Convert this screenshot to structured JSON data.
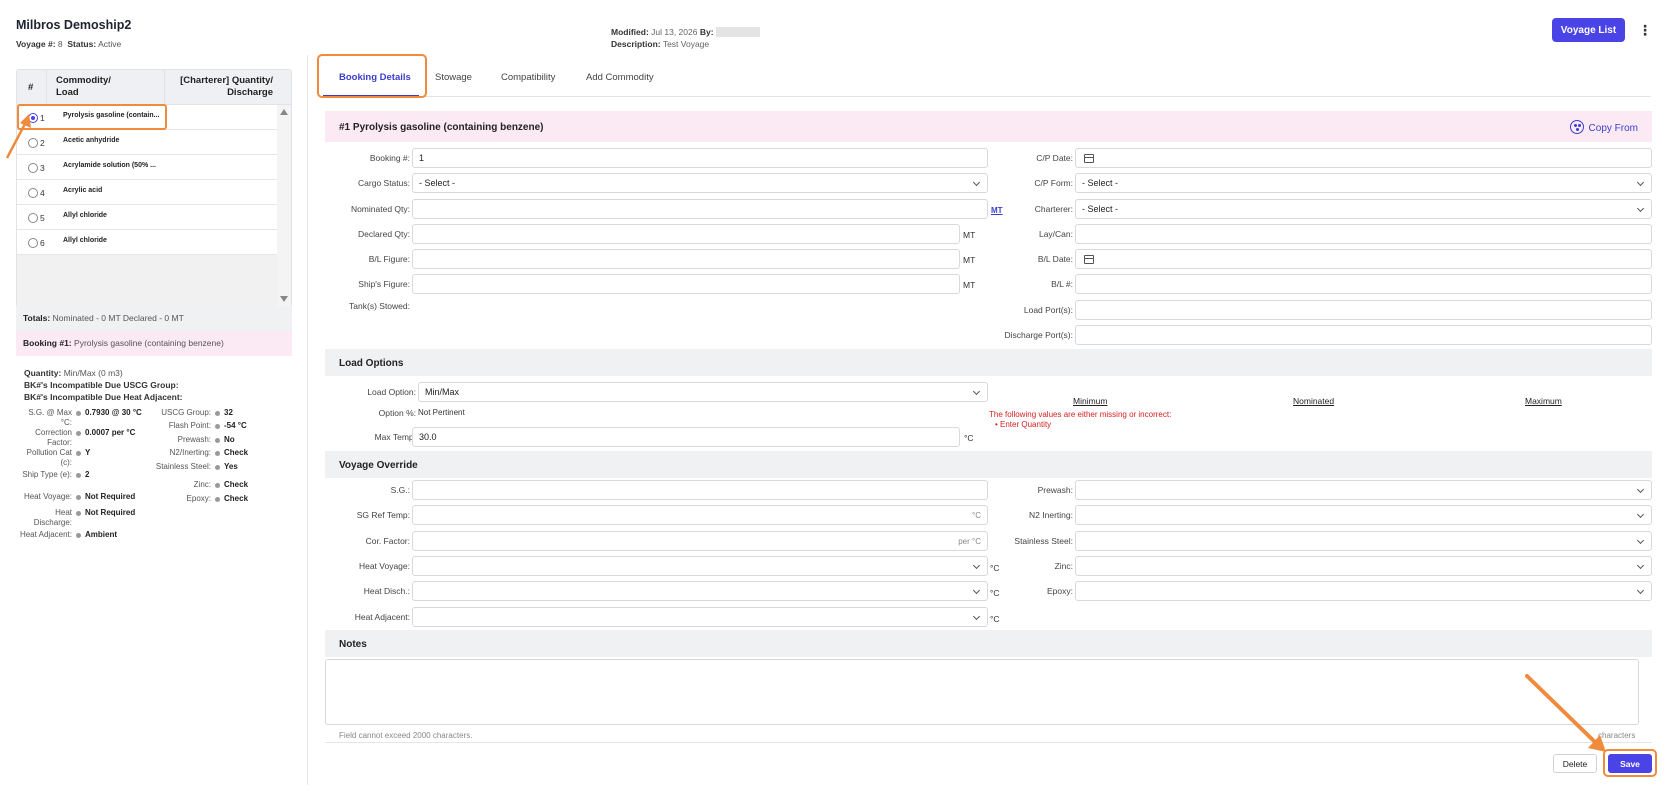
{
  "header": {
    "title": "Milbros Demoship2",
    "voyage_label": "Voyage #:",
    "voyage_value": "8",
    "status_label": "Status:",
    "status_value": "Active",
    "modified_label": "Modified:",
    "modified_value": "Jul 13, 2026",
    "by_label": "By:",
    "description_label": "Description:",
    "description_value": "Test Voyage",
    "voyage_list_button": "Voyage List"
  },
  "left_panel": {
    "columns": {
      "num": "#",
      "commodity_line1": "Commodity/",
      "commodity_line2": "Load",
      "qty_line1": "[Charterer] Quantity/",
      "qty_line2": "Discharge"
    },
    "rows": [
      {
        "num": "1",
        "name": "Pyrolysis gasoline (contain...",
        "selected": true
      },
      {
        "num": "2",
        "name": "Acetic anhydride",
        "selected": false
      },
      {
        "num": "3",
        "name": "Acrylamide solution (50% ...",
        "selected": false
      },
      {
        "num": "4",
        "name": "Acrylic acid",
        "selected": false
      },
      {
        "num": "5",
        "name": "Allyl chloride",
        "selected": false
      },
      {
        "num": "6",
        "name": "Allyl chloride",
        "selected": false
      }
    ],
    "totals_label": "Totals:",
    "totals_value": "Nominated - 0 MT Declared - 0 MT",
    "booking_label": "Booking #1:",
    "booking_value": "Pyrolysis gasoline (containing benzene)",
    "quantity_label": "Quantity:",
    "quantity_value": "Min/Max (0 m3)",
    "incompat_uscg": "BK#'s Incompatible Due USCG Group:",
    "incompat_heat": "BK#'s Incompatible Due Heat Adjacent:",
    "props_left": [
      {
        "label": "S.G. @ Max °C:",
        "value": "0.7930 @ 30 °C"
      },
      {
        "label": "Correction Factor:",
        "value": "0.0007 per °C"
      },
      {
        "label": "Pollution Cat (c):",
        "value": "Y"
      },
      {
        "label": "Ship Type (e):",
        "value": "2"
      },
      {
        "label": "Heat Voyage:",
        "value": "Not Required"
      },
      {
        "label": "Heat Discharge:",
        "value": "Not Required"
      },
      {
        "label": "Heat Adjacent:",
        "value": "Ambient"
      }
    ],
    "props_right": [
      {
        "label": "USCG Group:",
        "value": "32"
      },
      {
        "label": "Flash Point:",
        "value": "-54 °C"
      },
      {
        "label": "Prewash:",
        "value": "No"
      },
      {
        "label": "N2/Inerting:",
        "value": "Check"
      },
      {
        "label": "Stainless Steel:",
        "value": "Yes"
      },
      {
        "label": "Zinc:",
        "value": "Check"
      },
      {
        "label": "Epoxy:",
        "value": "Check"
      }
    ]
  },
  "tabs": [
    "Booking Details",
    "Stowage",
    "Compatibility",
    "Add Commodity"
  ],
  "booking": {
    "section_title": "#1 Pyrolysis gasoline (containing benzene)",
    "copy_from": "Copy From",
    "booking_no_label": "Booking #:",
    "booking_no_value": "1",
    "cargo_status_label": "Cargo Status:",
    "cargo_status_value": "- Select -",
    "nominated_qty_label": "Nominated Qty:",
    "nominated_unit": "MT",
    "declared_qty_label": "Declared Qty:",
    "bl_figure_label": "B/L Figure:",
    "ships_figure_label": "Ship's Figure:",
    "tanks_stowed_label": "Tank(s) Stowed:",
    "unit_mt": "MT",
    "cp_date_label": "C/P Date:",
    "cp_form_label": "C/P Form:",
    "cp_form_value": "- Select -",
    "charterer_label": "Charterer:",
    "charterer_value": "- Select -",
    "laycan_label": "Lay/Can:",
    "bl_date_label": "B/L Date:",
    "bl_no_label": "B/L #:",
    "load_ports_label": "Load Port(s):",
    "discharge_ports_label": "Discharge Port(s):"
  },
  "load_options": {
    "title": "Load Options",
    "load_option_label": "Load Option:",
    "load_option_value": "Min/Max",
    "option_pct_label": "Option %:",
    "option_pct_value": "Not Pertinent",
    "max_temp_label": "Max Temp:",
    "max_temp_value": "30.0",
    "max_temp_unit": "°C",
    "col_minimum": "Minimum",
    "col_nominated": "Nominated",
    "col_maximum": "Maximum",
    "error_title": "The following values are either missing or incorrect:",
    "error_item": "• Enter Quantity"
  },
  "voyage_override": {
    "title": "Voyage Override",
    "sg_label": "S.G.:",
    "sg_ref_temp_label": "SG Ref Temp:",
    "sg_ref_temp_suffix": "°C",
    "cor_factor_label": "Cor. Factor:",
    "cor_factor_suffix": "per °C",
    "heat_voyage_label": "Heat Voyage:",
    "heat_disch_label": "Heat Disch.:",
    "heat_adjacent_label": "Heat Adjacent:",
    "unit_c": "°C",
    "prewash_label": "Prewash:",
    "n2_inerting_label": "N2 Inerting:",
    "stainless_label": "Stainless Steel:",
    "zinc_label": "Zinc:",
    "epoxy_label": "Epoxy:"
  },
  "notes": {
    "title": "Notes",
    "hint": "Field cannot exceed 2000 characters.",
    "counter": "characters"
  },
  "actions": {
    "delete": "Delete",
    "save": "Save"
  },
  "colors": {
    "accent": "#4a43e6",
    "highlight": "#f08a3c",
    "pink": "#fbe9f3",
    "error": "#d62020"
  }
}
